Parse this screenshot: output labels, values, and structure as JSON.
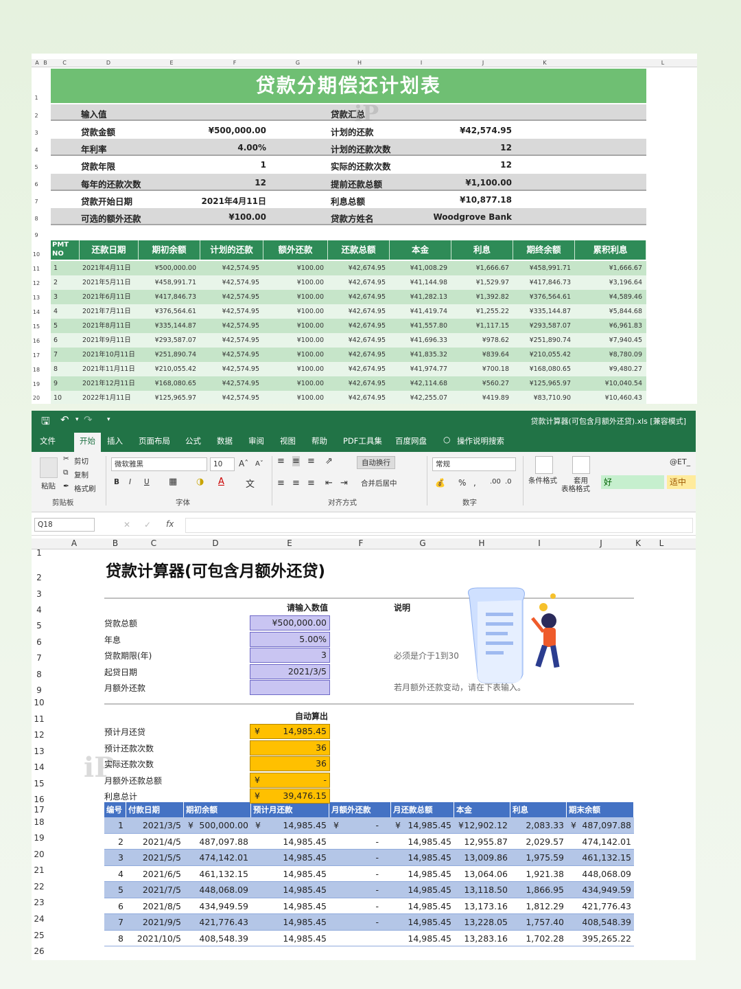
{
  "sheet1": {
    "col_headers": [
      "A",
      "B",
      "C",
      "D",
      "E",
      "F",
      "G",
      "H",
      "I",
      "J",
      "K",
      "L"
    ],
    "row_headers": [
      "1",
      "2",
      "3",
      "4",
      "5",
      "6",
      "7",
      "8",
      "9",
      "10",
      "11",
      "12",
      "13",
      "14",
      "15",
      "16",
      "17",
      "18",
      "19",
      "20"
    ],
    "title": "贷款分期偿还计划表",
    "inputs_label": "输入值",
    "summary_label": "贷款汇总",
    "left": [
      {
        "label": "贷款金额",
        "value": "¥500,000.00"
      },
      {
        "label": "年利率",
        "value": "4.00%"
      },
      {
        "label": "贷款年限",
        "value": "1"
      },
      {
        "label": "每年的还款次数",
        "value": "12"
      },
      {
        "label": "贷款开始日期",
        "value": "2021年4月11日"
      },
      {
        "label": "可选的额外还款",
        "value": "¥100.00"
      }
    ],
    "right": [
      {
        "label": "计划的还款",
        "value": "¥42,574.95"
      },
      {
        "label": "计划的还款次数",
        "value": "12"
      },
      {
        "label": "实际的还款次数",
        "value": "12"
      },
      {
        "label": "提前还款总额",
        "value": "¥1,100.00"
      },
      {
        "label": "利息总额",
        "value": "¥10,877.18"
      },
      {
        "label": "贷款方姓名",
        "value": "Woodgrove Bank"
      }
    ],
    "table_headers": [
      "PMT NO",
      "还款日期",
      "期初余额",
      "计划的还款",
      "额外还款",
      "还款总额",
      "本金",
      "利息",
      "期终余额",
      "累积利息"
    ],
    "rows": [
      [
        "1",
        "2021年4月11日",
        "¥500,000.00",
        "¥42,574.95",
        "¥100.00",
        "¥42,674.95",
        "¥41,008.29",
        "¥1,666.67",
        "¥458,991.71",
        "¥1,666.67"
      ],
      [
        "2",
        "2021年5月11日",
        "¥458,991.71",
        "¥42,574.95",
        "¥100.00",
        "¥42,674.95",
        "¥41,144.98",
        "¥1,529.97",
        "¥417,846.73",
        "¥3,196.64"
      ],
      [
        "3",
        "2021年6月11日",
        "¥417,846.73",
        "¥42,574.95",
        "¥100.00",
        "¥42,674.95",
        "¥41,282.13",
        "¥1,392.82",
        "¥376,564.61",
        "¥4,589.46"
      ],
      [
        "4",
        "2021年7月11日",
        "¥376,564.61",
        "¥42,574.95",
        "¥100.00",
        "¥42,674.95",
        "¥41,419.74",
        "¥1,255.22",
        "¥335,144.87",
        "¥5,844.68"
      ],
      [
        "5",
        "2021年8月11日",
        "¥335,144.87",
        "¥42,574.95",
        "¥100.00",
        "¥42,674.95",
        "¥41,557.80",
        "¥1,117.15",
        "¥293,587.07",
        "¥6,961.83"
      ],
      [
        "6",
        "2021年9月11日",
        "¥293,587.07",
        "¥42,574.95",
        "¥100.00",
        "¥42,674.95",
        "¥41,696.33",
        "¥978.62",
        "¥251,890.74",
        "¥7,940.45"
      ],
      [
        "7",
        "2021年10月11日",
        "¥251,890.74",
        "¥42,574.95",
        "¥100.00",
        "¥42,674.95",
        "¥41,835.32",
        "¥839.64",
        "¥210,055.42",
        "¥8,780.09"
      ],
      [
        "8",
        "2021年11月11日",
        "¥210,055.42",
        "¥42,574.95",
        "¥100.00",
        "¥42,674.95",
        "¥41,974.77",
        "¥700.18",
        "¥168,080.65",
        "¥9,480.27"
      ],
      [
        "9",
        "2021年12月11日",
        "¥168,080.65",
        "¥42,574.95",
        "¥100.00",
        "¥42,674.95",
        "¥42,114.68",
        "¥560.27",
        "¥125,965.97",
        "¥10,040.54"
      ],
      [
        "10",
        "2022年1月11日",
        "¥125,965.97",
        "¥42,574.95",
        "¥100.00",
        "¥42,674.95",
        "¥42,255.07",
        "¥419.89",
        "¥83,710.90",
        "¥10,460.43"
      ]
    ]
  },
  "excel": {
    "window_title": "贷款计算器(可包含月额外还贷).xls [兼容模式]",
    "tabs": [
      "文件",
      "开始",
      "插入",
      "页面布局",
      "公式",
      "数据",
      "审阅",
      "视图",
      "帮助",
      "PDF工具集",
      "百度网盘",
      "操作说明搜索"
    ],
    "active_tab": "开始",
    "ribbon": {
      "cut": "剪切",
      "copy": "复制",
      "format_painter": "格式刷",
      "paste": "粘贴",
      "clipboard": "剪贴板",
      "font_name": "微软雅黑",
      "font_size": "10",
      "font_group": "字体",
      "wrap": "自动换行",
      "merge": "合并后居中",
      "align_group": "对齐方式",
      "number_format": "常规",
      "number_group": "数字",
      "cond_format": "条件格式",
      "table_format_1": "套用",
      "table_format_2": "表格格式",
      "style_good": "好",
      "style_neutral": "适中",
      "style_et": "@ET_"
    },
    "name_box": "Q18",
    "fx": "fx",
    "col_headers": [
      "A",
      "B",
      "C",
      "D",
      "E",
      "F",
      "G",
      "H",
      "I",
      "J",
      "K",
      "L"
    ],
    "row_headers": [
      "1",
      "2",
      "3",
      "4",
      "5",
      "6",
      "7",
      "8",
      "9",
      "10",
      "11",
      "12",
      "13",
      "14",
      "15",
      "16",
      "17",
      "18",
      "19",
      "20",
      "21",
      "22",
      "23",
      "24",
      "25",
      "26"
    ],
    "title": "贷款计算器(可包含月额外还贷)",
    "input_header": "请输入数值",
    "note_header": "说明",
    "inputs": [
      {
        "label": "贷款总额",
        "value": "¥500,000.00"
      },
      {
        "label": "年息",
        "value": "5.00%"
      },
      {
        "label": "贷款期限(年)",
        "value": "3"
      },
      {
        "label": "起贷日期",
        "value": "2021/3/5"
      },
      {
        "label": "月额外还款",
        "value": ""
      }
    ],
    "note_1": "必须是介于1到30",
    "note_2": "若月额外还款变动，请在下表输入。",
    "output_header": "自动算出",
    "outputs": [
      {
        "label": "预计月还贷",
        "cur": "¥",
        "value": "14,985.45"
      },
      {
        "label": "预计还款次数",
        "cur": "",
        "value": "36"
      },
      {
        "label": "实际还款次数",
        "cur": "",
        "value": "36"
      },
      {
        "label": "月额外还款总额",
        "cur": "¥",
        "value": "-"
      },
      {
        "label": "利息总计",
        "cur": "¥",
        "value": "39,476.15"
      }
    ],
    "table_headers": [
      "编号",
      "付款日期",
      "期初余额",
      "预计月还款",
      "月额外还款",
      "月还款总额",
      "本金",
      "利息",
      "期末余额"
    ],
    "rows": [
      [
        "1",
        "2021/3/5",
        "500,000.00",
        "14,985.45",
        "-",
        "14,985.45",
        "12,902.12",
        "2,083.33",
        "487,097.88"
      ],
      [
        "2",
        "2021/4/5",
        "487,097.88",
        "14,985.45",
        "-",
        "14,985.45",
        "12,955.87",
        "2,029.57",
        "474,142.01"
      ],
      [
        "3",
        "2021/5/5",
        "474,142.01",
        "14,985.45",
        "-",
        "14,985.45",
        "13,009.86",
        "1,975.59",
        "461,132.15"
      ],
      [
        "4",
        "2021/6/5",
        "461,132.15",
        "14,985.45",
        "-",
        "14,985.45",
        "13,064.06",
        "1,921.38",
        "448,068.09"
      ],
      [
        "5",
        "2021/7/5",
        "448,068.09",
        "14,985.45",
        "-",
        "14,985.45",
        "13,118.50",
        "1,866.95",
        "434,949.59"
      ],
      [
        "6",
        "2021/8/5",
        "434,949.59",
        "14,985.45",
        "-",
        "14,985.45",
        "13,173.16",
        "1,812.29",
        "421,776.43"
      ],
      [
        "7",
        "2021/9/5",
        "421,776.43",
        "14,985.45",
        "-",
        "14,985.45",
        "13,228.05",
        "1,757.40",
        "408,548.39"
      ],
      [
        "8",
        "2021/10/5",
        "408,548.39",
        "14,985.45",
        "",
        "14,985.45",
        "13,283.16",
        "1,702.28",
        "395,265.22"
      ]
    ],
    "first_row_currency": "¥"
  },
  "watermark": "iP"
}
